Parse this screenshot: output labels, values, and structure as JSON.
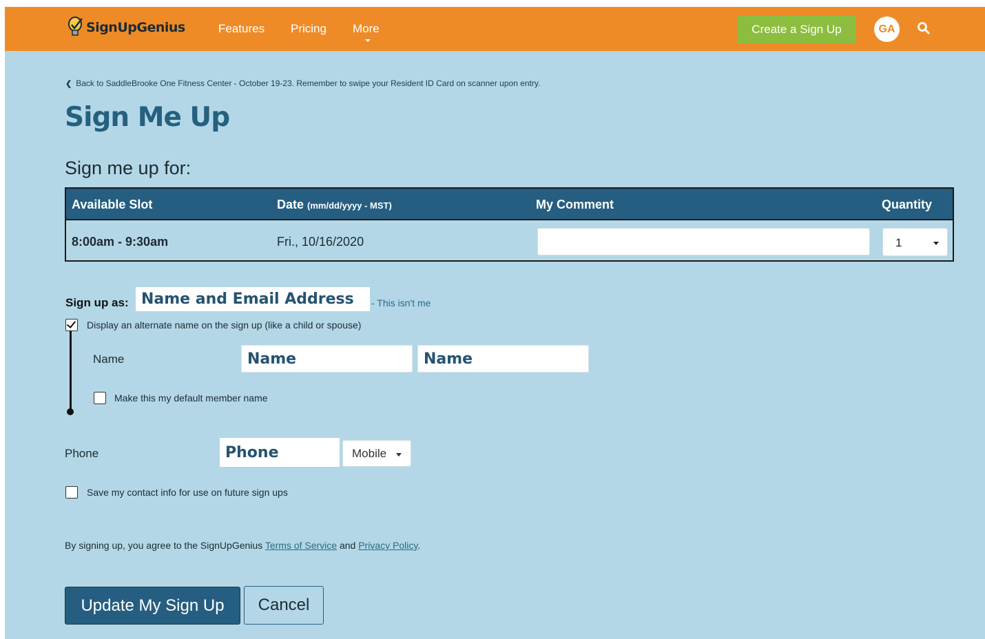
{
  "header": {
    "logo_text": "SignUpGenius",
    "nav": [
      "Features",
      "Pricing",
      "More"
    ],
    "create_button": "Create a Sign Up",
    "avatar_initials": "GA",
    "bg_color": "#ef8b27",
    "create_button_color": "#8cbd3e"
  },
  "back_link": "Back to SaddleBrooke One Fitness Center - October 19-23. Remember to swipe your Resident ID Card on scanner upon entry.",
  "page_title": "Sign Me Up",
  "section_title": "Sign me up for:",
  "table": {
    "headers": {
      "slot": "Available Slot",
      "date": "Date",
      "date_note": "(mm/dd/yyyy - MST)",
      "comment": "My Comment",
      "quantity": "Quantity"
    },
    "rows": [
      {
        "slot": "8:00am - 9:30am",
        "date": "Fri., 10/16/2020",
        "comment": "",
        "quantity": "1"
      }
    ]
  },
  "signup_as": {
    "label": "Sign up as:",
    "name_email_placeholder": "Name and Email Address",
    "not_me": "- This isn't me"
  },
  "alternate_name": {
    "checkbox_label": "Display an alternate name on the sign up (like a child or spouse)",
    "checked": true,
    "name_label": "Name",
    "first_name": "Name",
    "last_name": "Name",
    "default_label": "Make this my default member name",
    "default_checked": false
  },
  "phone": {
    "label": "Phone",
    "value": "Phone",
    "type": "Mobile"
  },
  "save_contact": {
    "label": "Save my contact info for use on future sign ups",
    "checked": false
  },
  "agreement": {
    "prefix": "By signing up, you agree to the SignUpGenius",
    "terms": "Terms of Service",
    "and": "and",
    "privacy": "Privacy Policy",
    "suffix": "."
  },
  "buttons": {
    "submit": "Update My Sign Up",
    "cancel": "Cancel"
  }
}
